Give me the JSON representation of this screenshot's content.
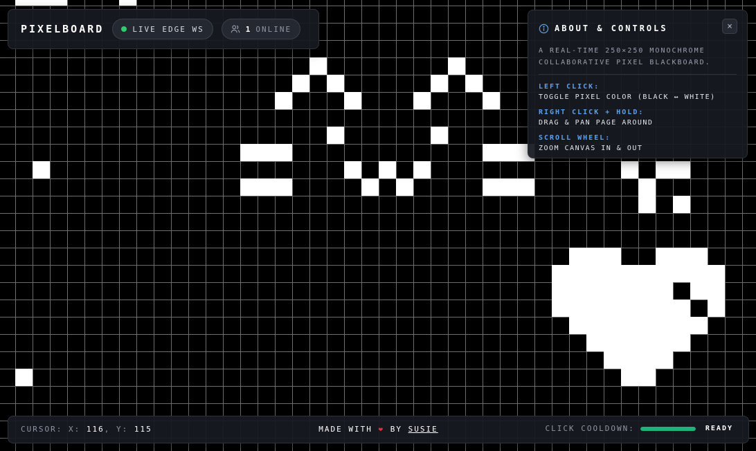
{
  "header": {
    "brand": "PIXELBOARD",
    "connection_label": "LIVE EDGE WS",
    "online_count": "1",
    "online_label": "ONLINE"
  },
  "about": {
    "title": "ABOUT & CONTROLS",
    "description": "A REAL-TIME 250×250 MONOCHROME COLLABORATIVE PIXEL BLACKBOARD.",
    "close_symbol": "×",
    "controls": [
      {
        "label": "LEFT CLICK:",
        "desc": "TOGGLE PIXEL COLOR (BLACK ↔ WHITE)"
      },
      {
        "label": "RIGHT CLICK + HOLD:",
        "desc": "DRAG & PAN PAGE AROUND"
      },
      {
        "label": "SCROLL WHEEL:",
        "desc": "ZOOM CANVAS IN & OUT"
      }
    ]
  },
  "footer": {
    "cursor_label": "CURSOR:",
    "cursor_x_label": "X:",
    "cursor_x": "116",
    "cursor_y_label": "Y:",
    "cursor_y": "115",
    "credit_prefix": "MADE WITH",
    "credit_heart": "❤",
    "credit_by": "BY",
    "author": "SUSIE",
    "cooldown_label": "CLICK COOLDOWN:",
    "cooldown_progress": 1.0,
    "cooldown_status": "READY"
  },
  "colors": {
    "online": "#2ecc71",
    "accent": "#5aa0f2",
    "cooldown": "#1fb37a",
    "heart": "#e0323c"
  },
  "icons": {
    "status": "status-dot-icon",
    "users": "users-icon",
    "info": "info-icon",
    "close": "close-icon",
    "heart": "heart-icon"
  }
}
